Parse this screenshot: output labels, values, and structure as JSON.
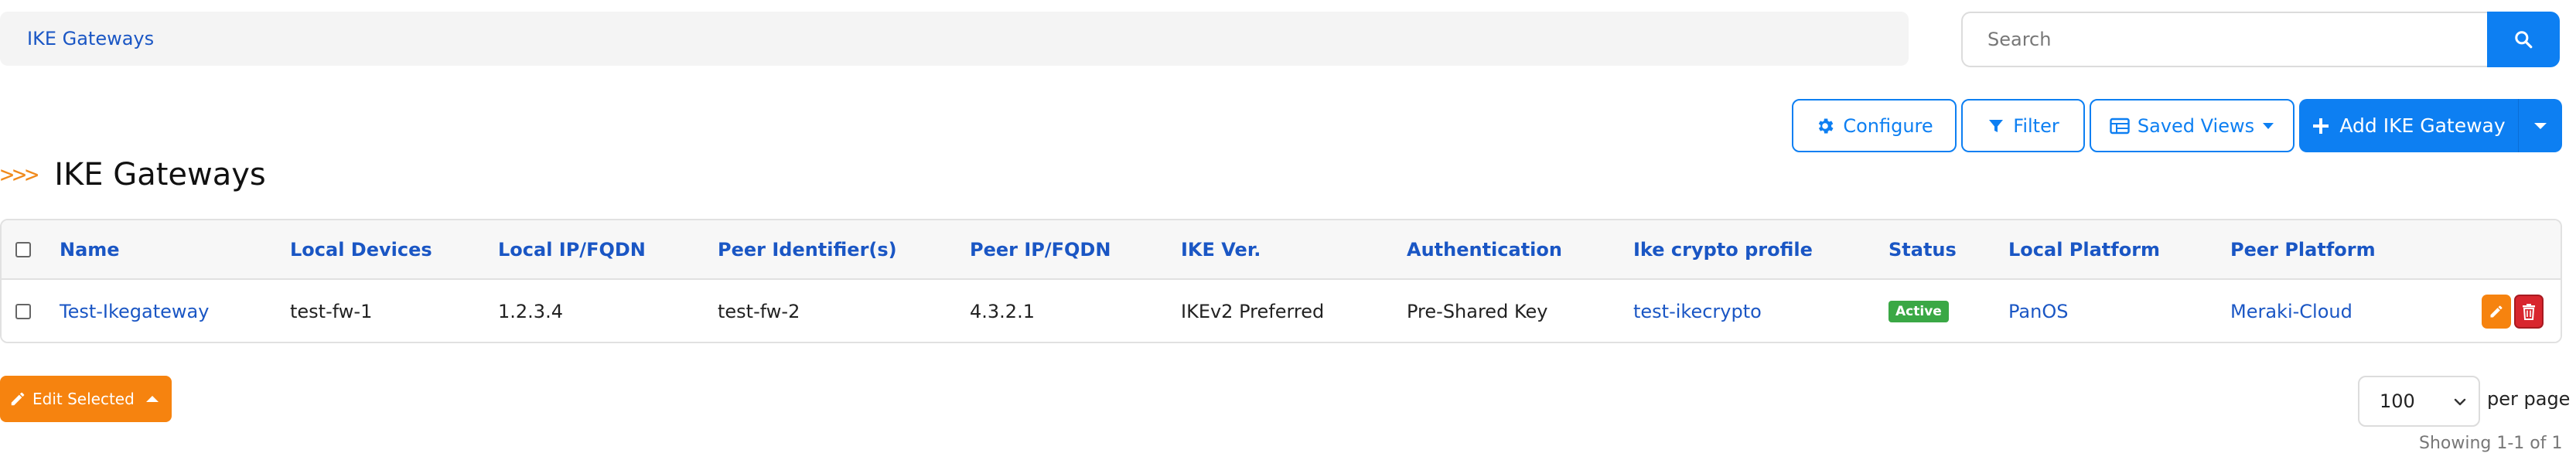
{
  "breadcrumb": {
    "current": "IKE Gateways"
  },
  "search": {
    "placeholder": "Search"
  },
  "toolbar": {
    "configure": "Configure",
    "filter": "Filter",
    "saved_views": "Saved Views",
    "add": "Add IKE Gateway"
  },
  "heading": {
    "arrows": ">>>",
    "title": "IKE Gateways"
  },
  "table": {
    "columns": [
      "Name",
      "Local Devices",
      "Local IP/FQDN",
      "Peer Identifier(s)",
      "Peer IP/FQDN",
      "IKE Ver.",
      "Authentication",
      "Ike crypto profile",
      "Status",
      "Local Platform",
      "Peer Platform"
    ],
    "rows": [
      {
        "name": "Test-Ikegateway",
        "local_devices": "test-fw-1",
        "local_ip": "1.2.3.4",
        "peer_identifiers": "test-fw-2",
        "peer_ip": "4.3.2.1",
        "ike_version": "IKEv2 Preferred",
        "authentication": "Pre-Shared Key",
        "ike_crypto_profile": "test-ikecrypto",
        "status": "Active",
        "local_platform": "PanOS",
        "peer_platform": "Meraki-Cloud"
      }
    ]
  },
  "footer": {
    "edit_selected": "Edit Selected",
    "per_page_value": "100",
    "per_page_label": "per page",
    "showing": "Showing 1-1 of 1"
  },
  "colors": {
    "primary": "#0d7ff2",
    "link": "#1a56c4",
    "accent_orange": "#f6830f",
    "status_active": "#3aa845",
    "delete_red": "#d8262e"
  },
  "icons": [
    "search-icon",
    "gear-icon",
    "filter-icon",
    "table-icon",
    "plus-icon",
    "caret-down-icon",
    "pencil-icon",
    "trash-icon",
    "caret-up-icon",
    "chevron-down-icon"
  ]
}
